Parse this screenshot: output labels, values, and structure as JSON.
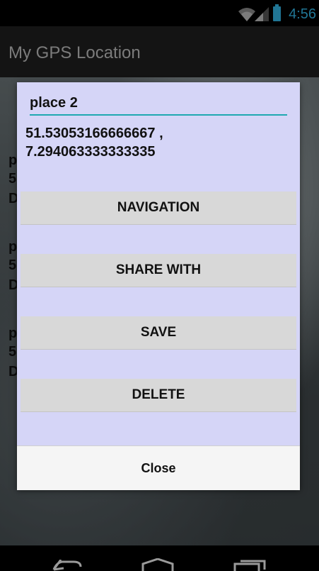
{
  "status_bar": {
    "time": "4:56",
    "icons": [
      "wifi-icon",
      "signal-icon",
      "battery-icon"
    ],
    "accent_color": "#33b5e5"
  },
  "action_bar": {
    "title": "My GPS Location"
  },
  "background_list": {
    "row_initials": [
      "p",
      "5",
      "D",
      "p",
      "5",
      "D",
      "p",
      "5",
      "D"
    ]
  },
  "dialog": {
    "place_name": "place 2",
    "coordinates_line1": "51.53053166666667 ,",
    "coordinates_line2": "7.294063333333335",
    "buttons": {
      "navigation": "NAVIGATION",
      "share": "SHARE WITH",
      "save": "SAVE",
      "delete": "DELETE"
    },
    "close_label": "Close",
    "background_color": "#d5d5f7",
    "underline_color": "#1fa8b0"
  },
  "nav_bar": {
    "icons": [
      "back-icon",
      "home-icon",
      "recents-icon"
    ]
  }
}
